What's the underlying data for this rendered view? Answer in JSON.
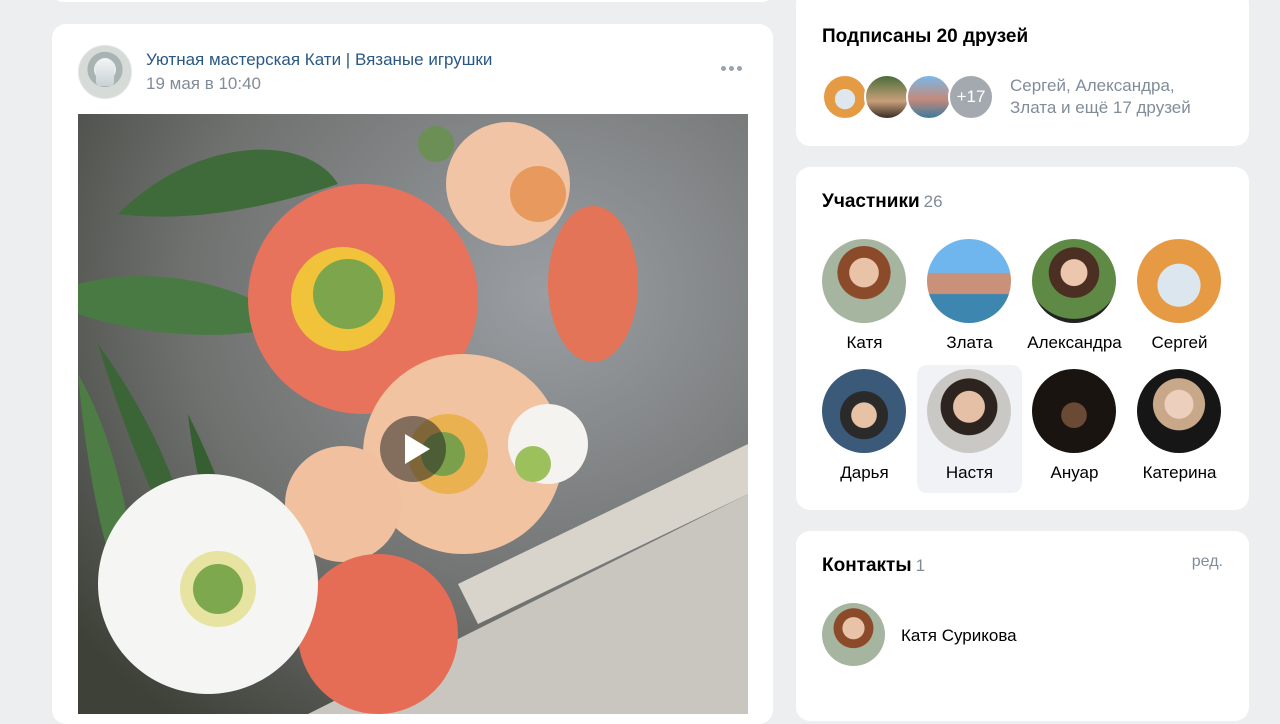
{
  "post": {
    "author": "Уютная мастерская Кати | Вязаные игрушки",
    "date": "19 мая в 10:40"
  },
  "friends": {
    "title": "Подписаны 20 друзей",
    "more": "+17",
    "names": "Сергей, Александра, Злата и ещё 17 друзей"
  },
  "members": {
    "title": "Участники",
    "count": "26",
    "list": [
      {
        "name": "Катя"
      },
      {
        "name": "Злата"
      },
      {
        "name": "Александра"
      },
      {
        "name": "Сергей"
      },
      {
        "name": "Дарья"
      },
      {
        "name": "Настя"
      },
      {
        "name": "Ануар"
      },
      {
        "name": "Катерина"
      }
    ]
  },
  "contacts": {
    "title": "Контакты",
    "count": "1",
    "edit": "ред.",
    "name": "Катя Сурикова"
  },
  "colors": {
    "link": "#2a5885",
    "secondary": "#818c99",
    "page_bg": "#edeef0"
  }
}
